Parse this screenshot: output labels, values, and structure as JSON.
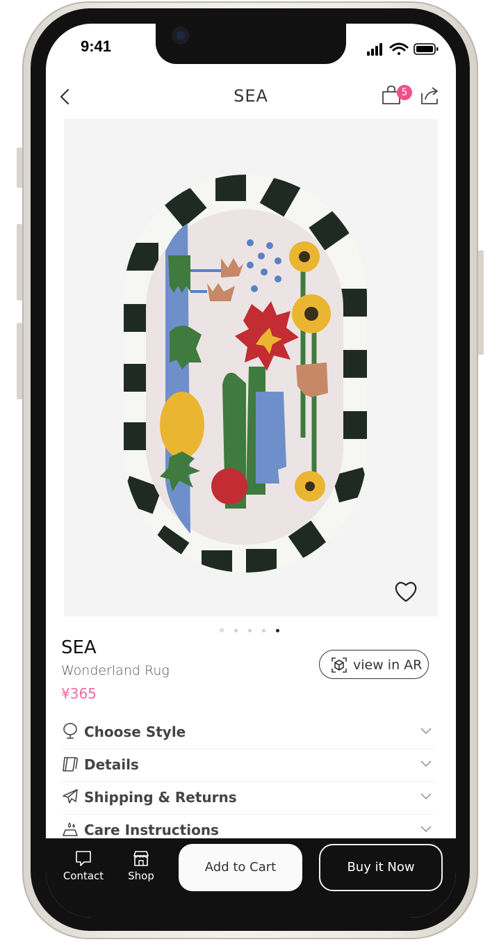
{
  "status_bar": {
    "time": "9:41"
  },
  "nav": {
    "title": "SEA",
    "cart_count": "5"
  },
  "product": {
    "name": "SEA",
    "subtitle": "Wonderland Rug",
    "price": "¥365",
    "ar_label": "view in AR",
    "image_count": 5,
    "active_image": 5
  },
  "accordion": [
    {
      "label": "Choose Style",
      "icon": "mirror-icon"
    },
    {
      "label": "Details",
      "icon": "rug-roll-icon"
    },
    {
      "label": "Shipping & Returns",
      "icon": "airplane-icon"
    },
    {
      "label": "Care Instructions",
      "icon": "care-icon"
    }
  ],
  "bottom_bar": {
    "contact_label": "Contact",
    "shop_label": "Shop",
    "add_to_cart_label": "Add to Cart",
    "buy_now_label": "Buy it Now"
  },
  "colors": {
    "accent_pink": "#f06a9b",
    "badge_pink": "#f0508a",
    "bottom_bar_bg": "#111111"
  }
}
